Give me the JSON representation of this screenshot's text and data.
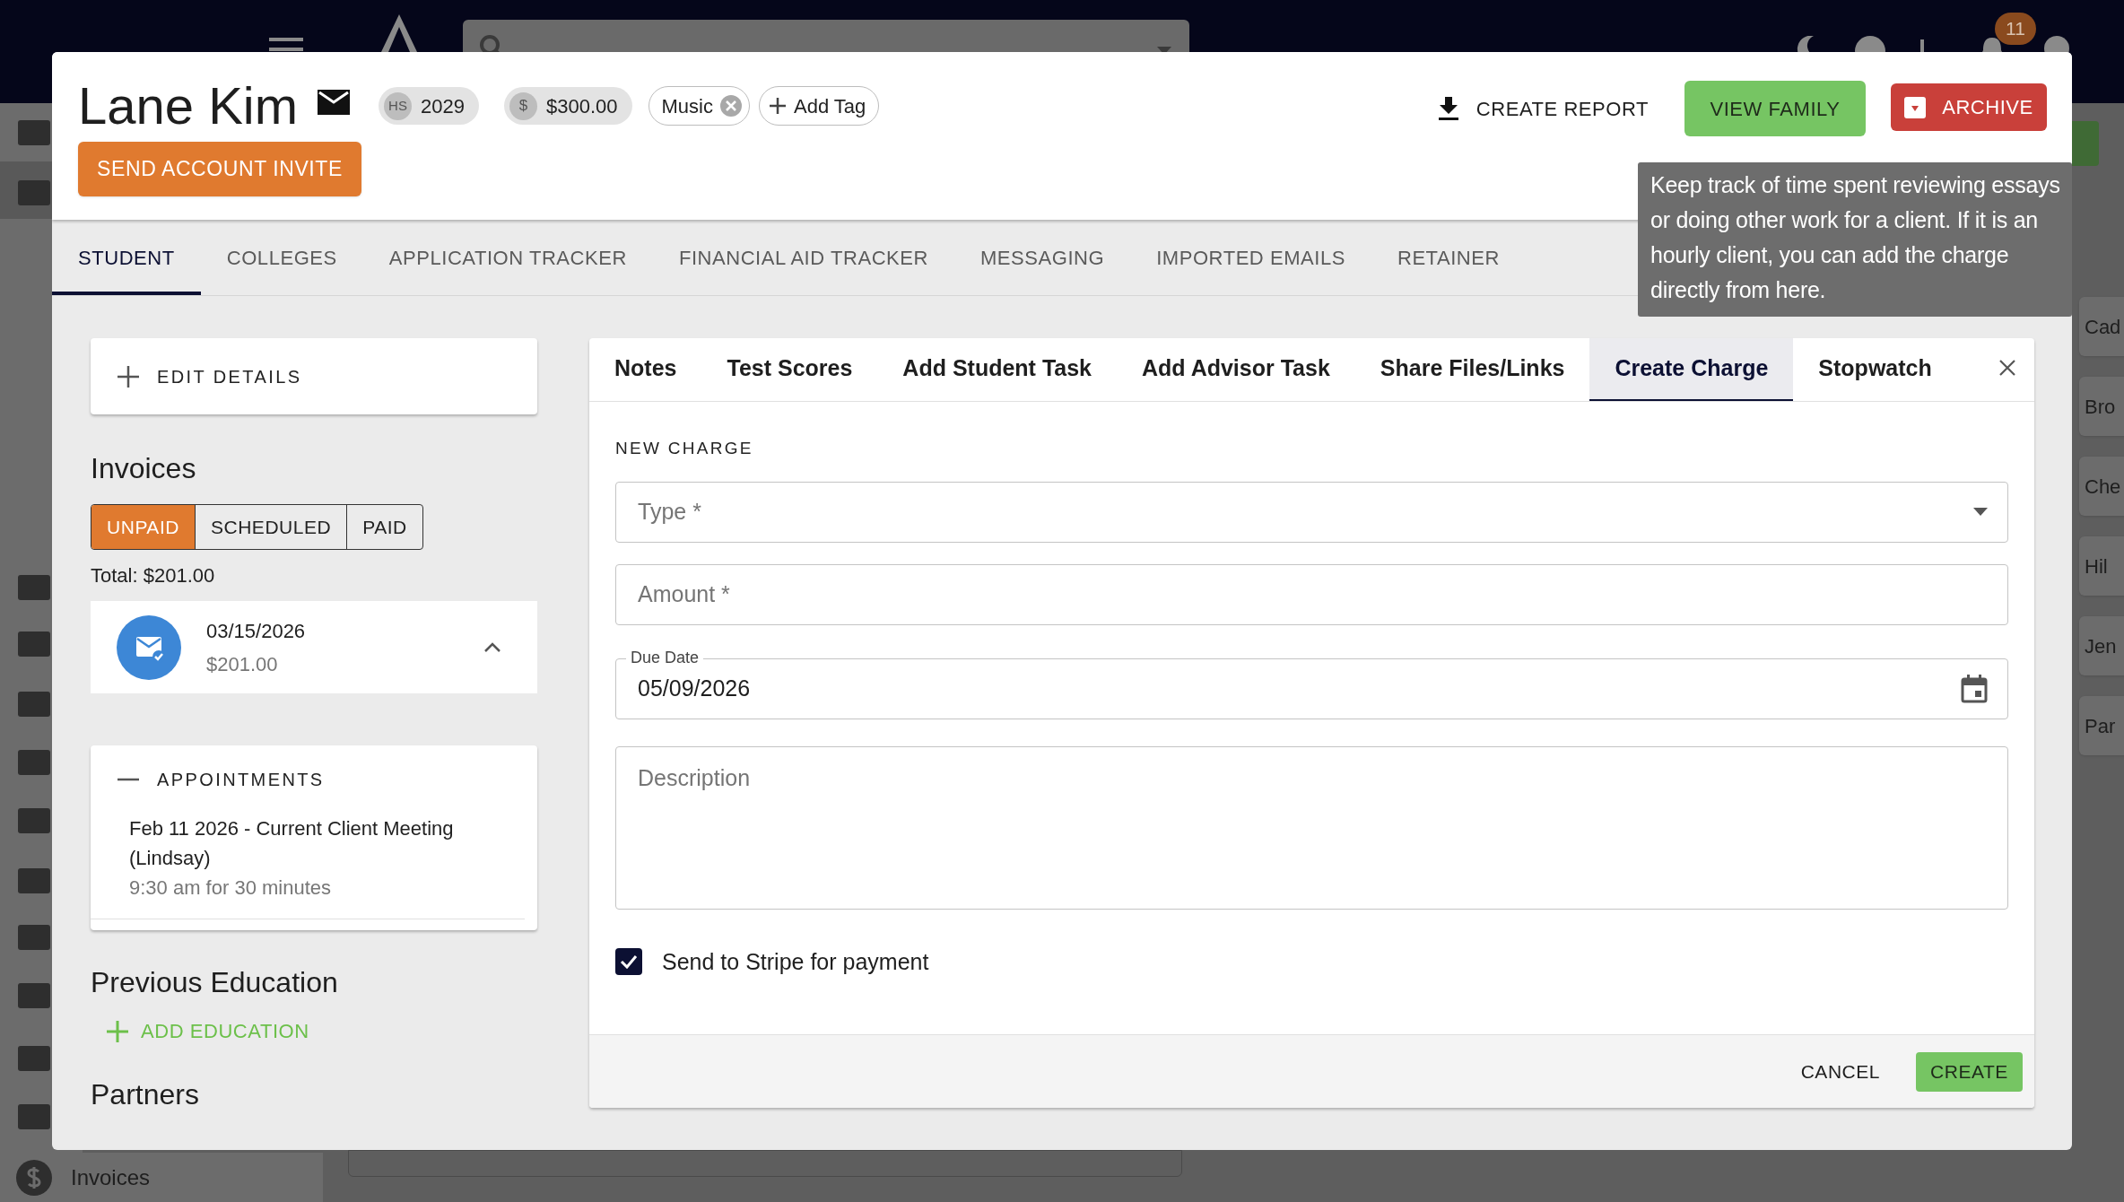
{
  "background": {
    "notification_count": "11",
    "nav_items": [
      {
        "label": "Invoices"
      }
    ],
    "side_cards": [
      {
        "label": "Cad"
      },
      {
        "label": "Bro"
      },
      {
        "label": "Che"
      },
      {
        "label": "Hil"
      },
      {
        "label": "Jen"
      },
      {
        "label": "Par"
      }
    ]
  },
  "header": {
    "name": "Lane Kim",
    "chips": [
      {
        "kind": "grad",
        "prefix": "HS",
        "label": "2029"
      },
      {
        "kind": "balance",
        "prefix": "$",
        "label": "$300.00"
      }
    ],
    "tags": [
      {
        "label": "Music"
      }
    ],
    "add_tag": "Add Tag",
    "invite_button": "SEND ACCOUNT INVITE",
    "create_report": "CREATE REPORT",
    "view_family": "VIEW FAMILY",
    "archive": "ARCHIVE"
  },
  "tabs": [
    {
      "label": "STUDENT",
      "selected": true
    },
    {
      "label": "COLLEGES",
      "selected": false
    },
    {
      "label": "APPLICATION TRACKER",
      "selected": false
    },
    {
      "label": "FINANCIAL AID TRACKER",
      "selected": false
    },
    {
      "label": "MESSAGING",
      "selected": false
    },
    {
      "label": "IMPORTED EMAILS",
      "selected": false
    },
    {
      "label": "RETAINER",
      "selected": false
    }
  ],
  "tooltip": "Keep track of time spent reviewing essays or doing other work for a client. If it is an hourly client, you can add the charge directly from here.",
  "left": {
    "edit_details": "EDIT DETAILS",
    "invoices": {
      "title": "Invoices",
      "filters": [
        {
          "label": "UNPAID",
          "selected": true
        },
        {
          "label": "SCHEDULED",
          "selected": false
        },
        {
          "label": "PAID",
          "selected": false
        }
      ],
      "total": "Total: $201.00",
      "items": [
        {
          "date": "03/15/2026",
          "amount": "$201.00",
          "expanded": true
        }
      ]
    },
    "appointments": {
      "title": "APPOINTMENTS",
      "expanded": true,
      "items": [
        {
          "title": "Feb 11 2026 - Current Client Meeting (Lindsay)",
          "time": "9:30 am for 30 minutes"
        }
      ]
    },
    "previous_education": {
      "title": "Previous Education",
      "add": "ADD EDUCATION"
    },
    "partners": {
      "title": "Partners"
    }
  },
  "panel": {
    "tabs": [
      {
        "label": "Notes",
        "selected": false
      },
      {
        "label": "Test Scores",
        "selected": false
      },
      {
        "label": "Add Student Task",
        "selected": false
      },
      {
        "label": "Add Advisor Task",
        "selected": false
      },
      {
        "label": "Share Files/Links",
        "selected": false
      },
      {
        "label": "Create Charge",
        "selected": true
      },
      {
        "label": "Stopwatch",
        "selected": false
      }
    ],
    "section": "NEW CHARGE",
    "fields": [
      {
        "kind": "select",
        "placeholder": "Type *"
      },
      {
        "kind": "text",
        "placeholder": "Amount *"
      },
      {
        "kind": "date",
        "label": "Due Date",
        "value": "05/09/2026"
      },
      {
        "kind": "textarea",
        "placeholder": "Description"
      }
    ],
    "stripe": {
      "label": "Send to Stripe for payment",
      "checked": true
    },
    "cancel": "CANCEL",
    "create": "CREATE"
  }
}
